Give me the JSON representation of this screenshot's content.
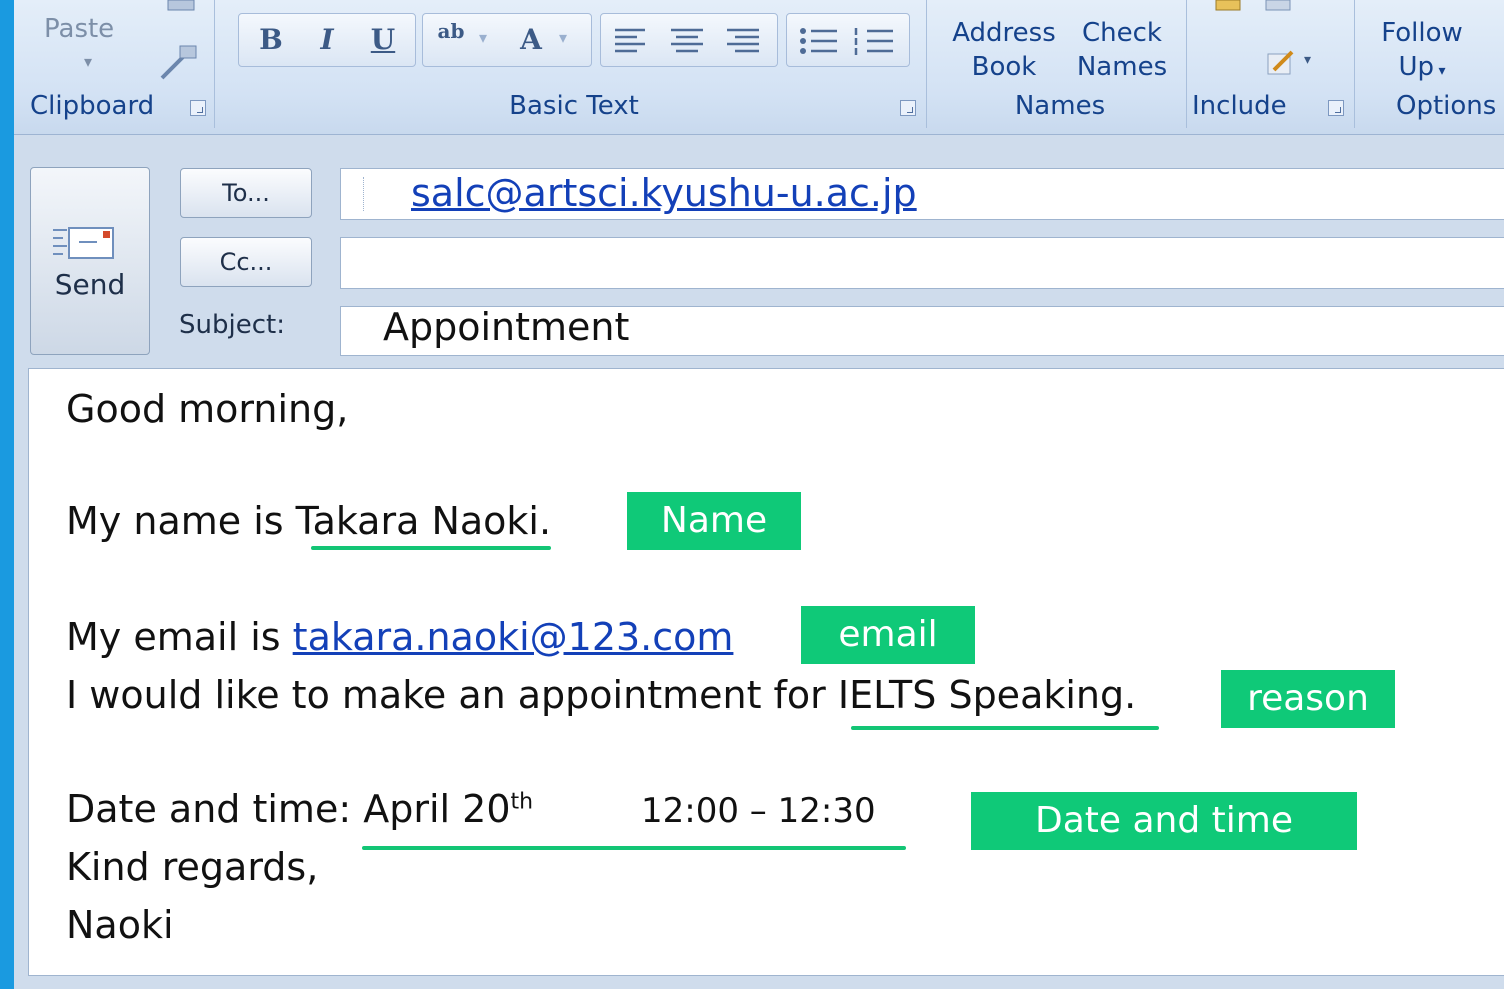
{
  "ribbon": {
    "clipboard": {
      "paste_label": "Paste",
      "group_label": "Clipboard"
    },
    "basic_text": {
      "group_label": "Basic Text",
      "bold": "B",
      "italic": "I",
      "underline": "U",
      "highlight": "ab",
      "font_color": "A"
    },
    "names": {
      "address_book_line1": "Address",
      "address_book_line2": "Book",
      "check_names_line1": "Check",
      "check_names_line2": "Names",
      "group_label": "Names"
    },
    "include": {
      "group_label": "Include"
    },
    "options": {
      "follow_up_line1": "Follow",
      "follow_up_line2": "Up",
      "group_label": "Options"
    }
  },
  "header": {
    "send_label": "Send",
    "to_button": "To...",
    "cc_button": "Cc...",
    "subject_label": "Subject:",
    "to_value": "salc@artsci.kyushu-u.ac.jp",
    "cc_value": "",
    "subject_value": "Appointment"
  },
  "body": {
    "greeting": "Good morning,",
    "name_prefix": "My name is ",
    "name_value": "Takara Naoki",
    "name_suffix": ".",
    "email_prefix": "My email is ",
    "email_value": "takara.naoki@123.com",
    "reason_prefix": "I would like to make an appointment for ",
    "reason_value": "IELTS Speaking",
    "reason_suffix": ".",
    "date_prefix": "Date and time: ",
    "date_value": "April 20",
    "date_suffix": "th",
    "time_value": "12:00 – 12:30",
    "closing": "Kind regards,",
    "signature": "Naoki"
  },
  "annotations": {
    "name": "Name",
    "email": "email",
    "reason": "reason",
    "datetime": "Date and time"
  },
  "colors": {
    "tag": "#0fc978",
    "underline": "#13c575",
    "link": "#1340b8",
    "ribbon_text": "#15428b"
  }
}
